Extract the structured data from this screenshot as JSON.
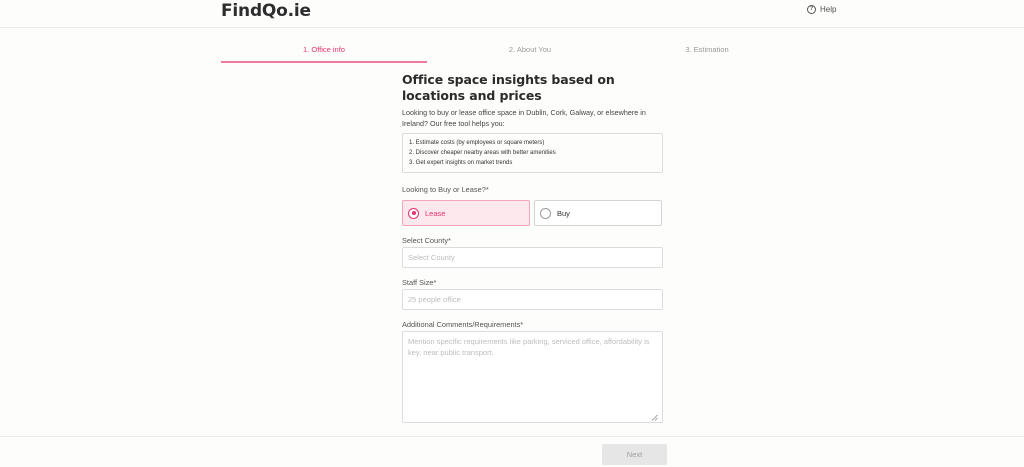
{
  "header": {
    "logo": "FindQo.ie",
    "help_label": "Help",
    "help_icon": "question-circle-icon"
  },
  "steps": [
    {
      "label": "1. Office info",
      "active": true
    },
    {
      "label": "2. About You",
      "active": false
    },
    {
      "label": "3. Estimation",
      "active": false
    }
  ],
  "main": {
    "title": "Office space insights based on locations and prices",
    "intro": "Looking to buy or lease office space in Dublin, Cork, Galway, or elsewhere in Ireland? Our free tool helps you:",
    "bullets": [
      "1. Estimate costs (by employees or square meters)",
      "2. Discover cheaper nearby areas with better amenities",
      "3. Get expert insights on market trends"
    ]
  },
  "form": {
    "buy_or_lease_label": "Looking to Buy or Lease?*",
    "options": {
      "lease": "Lease",
      "buy": "Buy",
      "selected": "Lease"
    },
    "county_label": "Select County*",
    "county_placeholder": "Select County",
    "staff_label": "Staff Size*",
    "staff_placeholder": "25 people office",
    "comments_label": "Additional Comments/Requirements*",
    "comments_placeholder": "Mention specific requirements like parking, serviced office, affordability is key, near public transport."
  },
  "footer": {
    "next_label": "Next"
  },
  "colors": {
    "accent": "#e4326d",
    "accent_bg": "#fde8ee"
  }
}
